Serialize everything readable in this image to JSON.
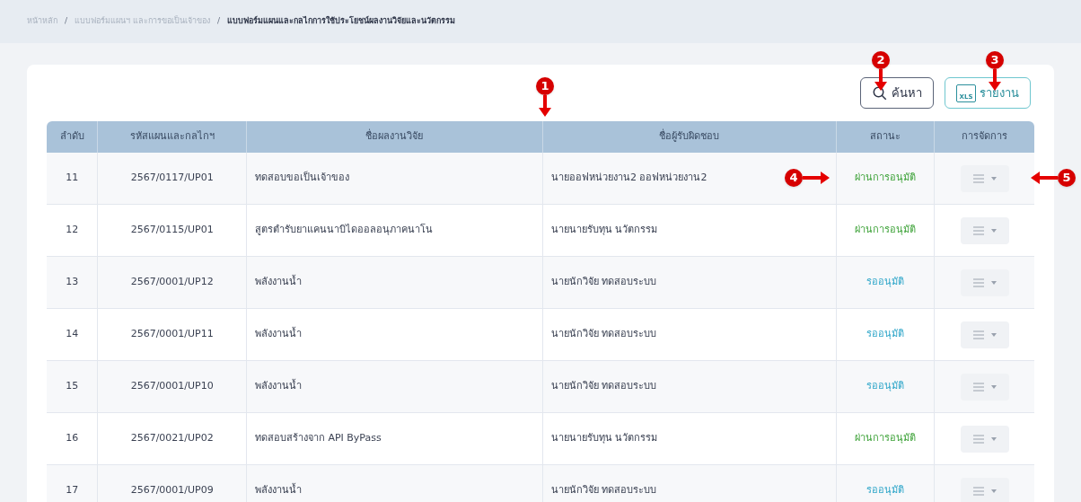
{
  "breadcrumb": [
    {
      "label": "หน้าหลัก",
      "current": false
    },
    {
      "label": "แบบฟอร์มแผนฯ และการขอเป็นเจ้าของ",
      "current": false
    },
    {
      "label": "แบบฟอร์มแผนและกลไกการใช้ประโยชน์ผลงานวิจัยและนวัตกรรม",
      "current": true
    }
  ],
  "breadcrumb_separator": "/",
  "toolbar": [
    {
      "kind": "search",
      "label": "ค้นหา"
    },
    {
      "kind": "report",
      "label": "รายงาน",
      "icon_text": "XLS"
    }
  ],
  "table": {
    "columns": [
      "ลำดับ",
      "รหัสแผนและกลไกฯ",
      "ชื่อผลงานวิจัย",
      "ชื่อผู้รับผิดชอบ",
      "สถานะ",
      "การจัดการ"
    ],
    "rows": [
      {
        "no": "11",
        "code": "2567/0117/UP01",
        "title": "ทดสอบขอเป็นเจ้าของ",
        "owner": "นายออฟหน่วยงาน2 ออฟหน่วยงาน2",
        "status": "ผ่านการอนุมัติ",
        "kind": "approved"
      },
      {
        "no": "12",
        "code": "2567/0115/UP01",
        "title": "สูตรตำรับยาแคนนาบิไดออลอนุภาคนาโน",
        "owner": "นายนายรับทุน นวัตกรรม",
        "status": "ผ่านการอนุมัติ",
        "kind": "approved"
      },
      {
        "no": "13",
        "code": "2567/0001/UP12",
        "title": "พลังงานน้ำ",
        "owner": "นายนักวิจัย ทดสอบระบบ",
        "status": "รออนุมัติ",
        "kind": "pending"
      },
      {
        "no": "14",
        "code": "2567/0001/UP11",
        "title": "พลังงานน้ำ",
        "owner": "นายนักวิจัย ทดสอบระบบ",
        "status": "รออนุมัติ",
        "kind": "pending"
      },
      {
        "no": "15",
        "code": "2567/0001/UP10",
        "title": "พลังงานน้ำ",
        "owner": "นายนักวิจัย ทดสอบระบบ",
        "status": "รออนุมัติ",
        "kind": "pending"
      },
      {
        "no": "16",
        "code": "2567/0021/UP02",
        "title": "ทดสอบสร้างจาก API ByPass",
        "owner": "นายนายรับทุน นวัตกรรม",
        "status": "ผ่านการอนุมัติ",
        "kind": "approved"
      },
      {
        "no": "17",
        "code": "2567/0001/UP09",
        "title": "พลังงานน้ำ",
        "owner": "นายนักวิจัย ทดสอบระบบ",
        "status": "รออนุมัติ",
        "kind": "pending"
      }
    ]
  },
  "callouts": [
    {
      "label": "1",
      "kind": "down"
    },
    {
      "label": "2",
      "kind": "down"
    },
    {
      "label": "3",
      "kind": "down"
    },
    {
      "label": "4",
      "kind": "right"
    },
    {
      "label": "5",
      "kind": "left"
    }
  ]
}
